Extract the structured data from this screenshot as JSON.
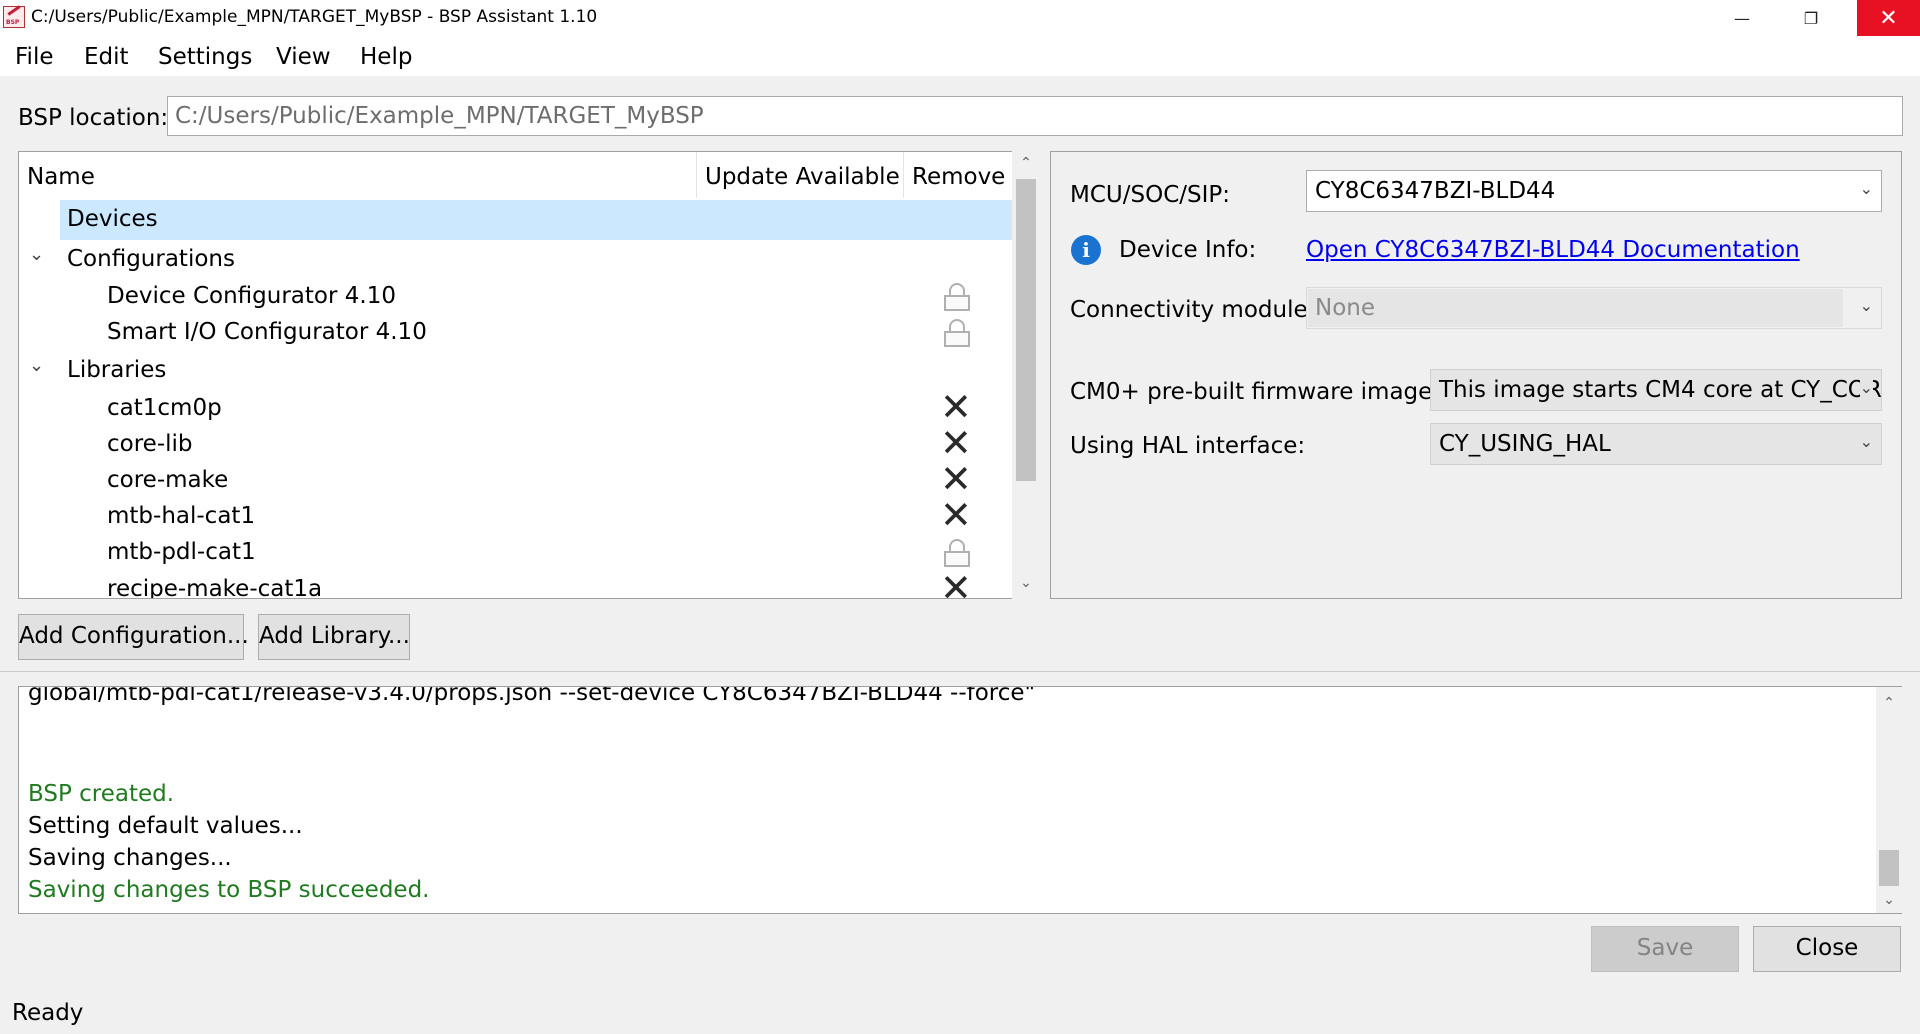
{
  "window": {
    "title": "C:/Users/Public/Example_MPN/TARGET_MyBSP - BSP Assistant 1.10",
    "icon_text": "BSP",
    "min_glyph": "—",
    "max_glyph": "❐",
    "close_glyph": "✕"
  },
  "menu": [
    {
      "label": "File"
    },
    {
      "label": "Edit"
    },
    {
      "label": "Settings"
    },
    {
      "label": "View"
    },
    {
      "label": "Help"
    }
  ],
  "bsp_location": {
    "label": "BSP location:",
    "value": "C:/Users/Public/Example_MPN/TARGET_MyBSP"
  },
  "tree": {
    "columns": [
      "Name",
      "Update Available",
      "Remove"
    ],
    "devices": "Devices",
    "configurations": {
      "label": "Configurations",
      "items": [
        {
          "name": "Device Configurator 4.10",
          "remove": "locked"
        },
        {
          "name": "Smart I/O Configurator 4.10",
          "remove": "locked"
        }
      ]
    },
    "libraries": {
      "label": "Libraries",
      "items": [
        {
          "name": "cat1cm0p",
          "remove": "delete"
        },
        {
          "name": "core-lib",
          "remove": "delete"
        },
        {
          "name": "core-make",
          "remove": "delete"
        },
        {
          "name": "mtb-hal-cat1",
          "remove": "delete"
        },
        {
          "name": "mtb-pdl-cat1",
          "remove": "locked"
        },
        {
          "name": "recipe-make-cat1a",
          "remove": "delete"
        }
      ]
    },
    "chevron_glyph": "⌄",
    "x_glyph": "✕"
  },
  "properties": {
    "mcu_label": "MCU/SOC/SIP:",
    "mcu_value": "CY8C6347BZI-BLD44",
    "device_info_label": "Device Info:",
    "device_info_link": "Open CY8C6347BZI-BLD44 Documentation",
    "connectivity_label": "Connectivity module:",
    "connectivity_value": "None",
    "cm0_label": "CM0+ pre-built firmware image:",
    "cm0_value": "This image starts CM4 core at CY_COR",
    "hal_label": "Using HAL interface:",
    "hal_value": "CY_USING_HAL",
    "info_glyph": "i",
    "dropdown_glyph": "⌄"
  },
  "buttons": {
    "add_configuration": "Add Configuration...",
    "add_library": "Add Library...",
    "save": "Save",
    "close": "Close"
  },
  "log": [
    {
      "text": "global/mtb-pdl-cat1/release-v3.4.0/props.json --set-device CY8C6347BZI-BLD44 --force\"",
      "kind": "normal"
    },
    {
      "text": "BSP created.",
      "kind": "success"
    },
    {
      "text": "Setting default values...",
      "kind": "normal"
    },
    {
      "text": "Saving changes...",
      "kind": "normal"
    },
    {
      "text": "Saving changes to BSP succeeded.",
      "kind": "success"
    }
  ],
  "scroll": {
    "up_glyph": "⌃",
    "down_glyph": "⌄"
  },
  "status": "Ready",
  "colors": {
    "selection": "#cce8ff",
    "success_text": "#207a20",
    "link": "#0000ee",
    "close_button": "#e81123"
  }
}
